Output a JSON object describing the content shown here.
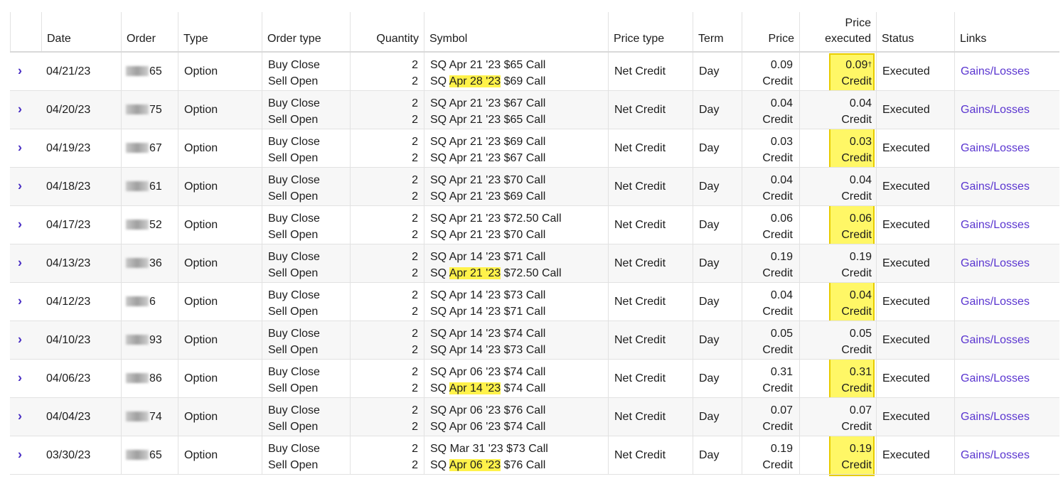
{
  "columns": {
    "date": "Date",
    "order": "Order",
    "type": "Type",
    "order_type": "Order type",
    "quantity": "Quantity",
    "symbol": "Symbol",
    "price_type": "Price type",
    "term": "Term",
    "price": "Price",
    "price_executed_1": "Price",
    "price_executed_2": "executed",
    "status": "Status",
    "links": "Links"
  },
  "rows": [
    {
      "date": "04/21/23",
      "order_suffix": "65",
      "type": "Option",
      "leg1_action": "Buy Close",
      "leg2_action": "Sell Open",
      "leg1_qty": "2",
      "leg2_qty": "2",
      "leg1_symbol": "SQ Apr 21 '23 $65 Call",
      "leg2_symbol_pre": "SQ ",
      "leg2_symbol_date": "Apr 28 '23",
      "leg2_symbol_post": " $69 Call",
      "leg2_highlight": true,
      "price_type": "Net Credit",
      "term": "Day",
      "price": "0.09",
      "price_unit": "Credit",
      "exec_price": "0.09",
      "exec_mark": "†",
      "exec_unit": "Credit",
      "status": "Executed",
      "link": "Gains/Losses"
    },
    {
      "date": "04/20/23",
      "order_suffix": "75",
      "type": "Option",
      "leg1_action": "Buy Close",
      "leg2_action": "Sell Open",
      "leg1_qty": "2",
      "leg2_qty": "2",
      "leg1_symbol": "SQ Apr 21 '23 $67 Call",
      "leg2_symbol_pre": "SQ ",
      "leg2_symbol_date": "Apr 21 '23",
      "leg2_symbol_post": " $65 Call",
      "leg2_highlight": false,
      "price_type": "Net Credit",
      "term": "Day",
      "price": "0.04",
      "price_unit": "Credit",
      "exec_price": "0.04",
      "exec_mark": "",
      "exec_unit": "Credit",
      "status": "Executed",
      "link": "Gains/Losses"
    },
    {
      "date": "04/19/23",
      "order_suffix": "67",
      "type": "Option",
      "leg1_action": "Buy Close",
      "leg2_action": "Sell Open",
      "leg1_qty": "2",
      "leg2_qty": "2",
      "leg1_symbol": "SQ Apr 21 '23 $69 Call",
      "leg2_symbol_pre": "SQ ",
      "leg2_symbol_date": "Apr 21 '23",
      "leg2_symbol_post": " $67 Call",
      "leg2_highlight": false,
      "price_type": "Net Credit",
      "term": "Day",
      "price": "0.03",
      "price_unit": "Credit",
      "exec_price": "0.03",
      "exec_mark": "",
      "exec_unit": "Credit",
      "status": "Executed",
      "link": "Gains/Losses"
    },
    {
      "date": "04/18/23",
      "order_suffix": "61",
      "type": "Option",
      "leg1_action": "Buy Close",
      "leg2_action": "Sell Open",
      "leg1_qty": "2",
      "leg2_qty": "2",
      "leg1_symbol": "SQ Apr 21 '23 $70 Call",
      "leg2_symbol_pre": "SQ ",
      "leg2_symbol_date": "Apr 21 '23",
      "leg2_symbol_post": " $69 Call",
      "leg2_highlight": false,
      "price_type": "Net Credit",
      "term": "Day",
      "price": "0.04",
      "price_unit": "Credit",
      "exec_price": "0.04",
      "exec_mark": "",
      "exec_unit": "Credit",
      "status": "Executed",
      "link": "Gains/Losses"
    },
    {
      "date": "04/17/23",
      "order_suffix": "52",
      "type": "Option",
      "leg1_action": "Buy Close",
      "leg2_action": "Sell Open",
      "leg1_qty": "2",
      "leg2_qty": "2",
      "leg1_symbol": "SQ Apr 21 '23 $72.50 Call",
      "leg2_symbol_pre": "SQ ",
      "leg2_symbol_date": "Apr 21 '23",
      "leg2_symbol_post": " $70 Call",
      "leg2_highlight": false,
      "price_type": "Net Credit",
      "term": "Day",
      "price": "0.06",
      "price_unit": "Credit",
      "exec_price": "0.06",
      "exec_mark": "",
      "exec_unit": "Credit",
      "status": "Executed",
      "link": "Gains/Losses"
    },
    {
      "date": "04/13/23",
      "order_suffix": "36",
      "type": "Option",
      "leg1_action": "Buy Close",
      "leg2_action": "Sell Open",
      "leg1_qty": "2",
      "leg2_qty": "2",
      "leg1_symbol": "SQ Apr 14 '23 $71 Call",
      "leg2_symbol_pre": "SQ ",
      "leg2_symbol_date": "Apr 21 '23",
      "leg2_symbol_post": " $72.50 Call",
      "leg2_highlight": true,
      "price_type": "Net Credit",
      "term": "Day",
      "price": "0.19",
      "price_unit": "Credit",
      "exec_price": "0.19",
      "exec_mark": "",
      "exec_unit": "Credit",
      "status": "Executed",
      "link": "Gains/Losses"
    },
    {
      "date": "04/12/23",
      "order_suffix": "6",
      "type": "Option",
      "leg1_action": "Buy Close",
      "leg2_action": "Sell Open",
      "leg1_qty": "2",
      "leg2_qty": "2",
      "leg1_symbol": "SQ Apr 14 '23 $73 Call",
      "leg2_symbol_pre": "SQ ",
      "leg2_symbol_date": "Apr 14 '23",
      "leg2_symbol_post": " $71 Call",
      "leg2_highlight": false,
      "price_type": "Net Credit",
      "term": "Day",
      "price": "0.04",
      "price_unit": "Credit",
      "exec_price": "0.04",
      "exec_mark": "",
      "exec_unit": "Credit",
      "status": "Executed",
      "link": "Gains/Losses"
    },
    {
      "date": "04/10/23",
      "order_suffix": "93",
      "type": "Option",
      "leg1_action": "Buy Close",
      "leg2_action": "Sell Open",
      "leg1_qty": "2",
      "leg2_qty": "2",
      "leg1_symbol": "SQ Apr 14 '23 $74 Call",
      "leg2_symbol_pre": "SQ ",
      "leg2_symbol_date": "Apr 14 '23",
      "leg2_symbol_post": " $73 Call",
      "leg2_highlight": false,
      "price_type": "Net Credit",
      "term": "Day",
      "price": "0.05",
      "price_unit": "Credit",
      "exec_price": "0.05",
      "exec_mark": "",
      "exec_unit": "Credit",
      "status": "Executed",
      "link": "Gains/Losses"
    },
    {
      "date": "04/06/23",
      "order_suffix": "86",
      "type": "Option",
      "leg1_action": "Buy Close",
      "leg2_action": "Sell Open",
      "leg1_qty": "2",
      "leg2_qty": "2",
      "leg1_symbol": "SQ Apr 06 '23 $74 Call",
      "leg2_symbol_pre": "SQ ",
      "leg2_symbol_date": "Apr 14 '23",
      "leg2_symbol_post": " $74 Call",
      "leg2_highlight": true,
      "price_type": "Net Credit",
      "term": "Day",
      "price": "0.31",
      "price_unit": "Credit",
      "exec_price": "0.31",
      "exec_mark": "",
      "exec_unit": "Credit",
      "status": "Executed",
      "link": "Gains/Losses"
    },
    {
      "date": "04/04/23",
      "order_suffix": "74",
      "type": "Option",
      "leg1_action": "Buy Close",
      "leg2_action": "Sell Open",
      "leg1_qty": "2",
      "leg2_qty": "2",
      "leg1_symbol": "SQ Apr 06 '23 $76 Call",
      "leg2_symbol_pre": "SQ ",
      "leg2_symbol_date": "Apr 06 '23",
      "leg2_symbol_post": " $74 Call",
      "leg2_highlight": false,
      "price_type": "Net Credit",
      "term": "Day",
      "price": "0.07",
      "price_unit": "Credit",
      "exec_price": "0.07",
      "exec_mark": "",
      "exec_unit": "Credit",
      "status": "Executed",
      "link": "Gains/Losses"
    },
    {
      "date": "03/30/23",
      "order_suffix": "65",
      "type": "Option",
      "leg1_action": "Buy Close",
      "leg2_action": "Sell Open",
      "leg1_qty": "2",
      "leg2_qty": "2",
      "leg1_symbol": "SQ Mar 31 '23 $73 Call",
      "leg2_symbol_pre": "SQ ",
      "leg2_symbol_date": "Apr 06 '23",
      "leg2_symbol_post": " $76 Call",
      "leg2_highlight": true,
      "price_type": "Net Credit",
      "term": "Day",
      "price": "0.19",
      "price_unit": "Credit",
      "exec_price": "0.19",
      "exec_mark": "",
      "exec_unit": "Credit",
      "status": "Executed",
      "link": "Gains/Losses"
    }
  ],
  "icons": {
    "expand": "chevron-right-icon"
  },
  "colors": {
    "link": "#5a35d0",
    "highlight": "#fff24a",
    "exec_column": "#fff766"
  }
}
